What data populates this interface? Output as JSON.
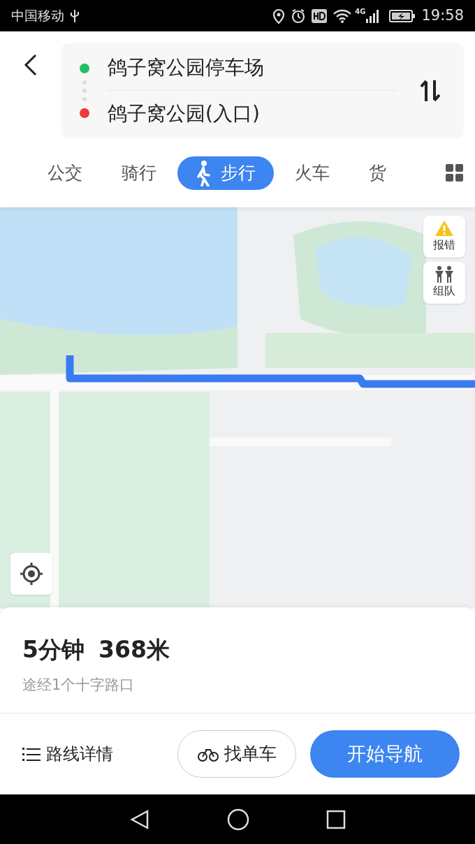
{
  "status_bar": {
    "carrier": "中国移动",
    "time": "19:58",
    "network": "4G"
  },
  "route": {
    "origin": "鸽子窝公园停车场",
    "destination": "鸽子窝公园(入口)"
  },
  "tabs": [
    {
      "label": "公交",
      "selected": false
    },
    {
      "label": "骑行",
      "selected": false
    },
    {
      "label": "步行",
      "selected": true
    },
    {
      "label": "火车",
      "selected": false
    },
    {
      "label": "货",
      "selected": false
    }
  ],
  "map": {
    "tools": [
      {
        "label": "报错",
        "kind": "warning"
      },
      {
        "label": "组队",
        "kind": "team"
      }
    ]
  },
  "summary": {
    "duration": "5分钟",
    "distance": "368米",
    "note": "途经1个十字路口"
  },
  "actions": {
    "details": "路线详情",
    "bike": "找单车",
    "navigate": "开始导航"
  }
}
